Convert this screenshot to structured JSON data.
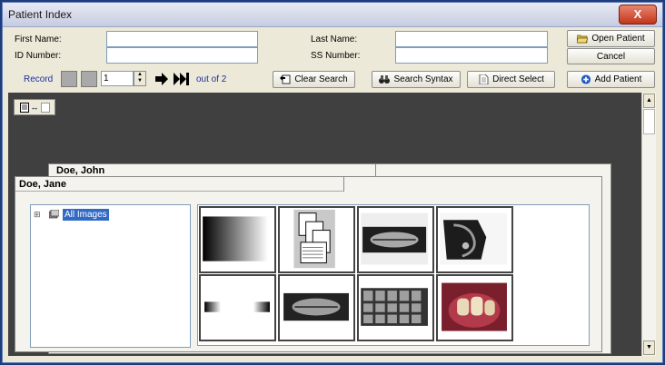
{
  "window": {
    "title": "Patient Index",
    "close_label": "X"
  },
  "form": {
    "first_name_label": "First Name:",
    "id_number_label": "ID Number:",
    "last_name_label": "Last Name:",
    "ss_number_label": "SS Number:",
    "first_name_value": "",
    "id_number_value": "",
    "last_name_value": "",
    "ss_number_value": ""
  },
  "buttons": {
    "open_patient": "Open Patient",
    "cancel": "Cancel",
    "clear_search": "Clear Search",
    "search_syntax": "Search Syntax",
    "direct_select": "Direct Select",
    "add_patient": "Add Patient"
  },
  "record_nav": {
    "label": "Record",
    "value": "1",
    "out_of": "out of 2"
  },
  "patients": [
    {
      "name": "Doe, John"
    },
    {
      "name": "Doe, Jane"
    }
  ],
  "tree": {
    "root_label": "All Images",
    "expand_symbol": "⊞"
  },
  "gallery": {
    "images": [
      {
        "type": "gradient-strip-icon"
      },
      {
        "type": "documents-icon"
      },
      {
        "type": "panoramic-xray"
      },
      {
        "type": "cephalometric-xray"
      },
      {
        "type": "white-strip-icon"
      },
      {
        "type": "panoramic-xray"
      },
      {
        "type": "bitewing-series"
      },
      {
        "type": "intraoral-photo"
      }
    ]
  },
  "colors": {
    "title_bg": "#d6dbea",
    "close_red": "#c2361c",
    "dark_pane": "#404040",
    "selection_blue": "#316ac5"
  }
}
